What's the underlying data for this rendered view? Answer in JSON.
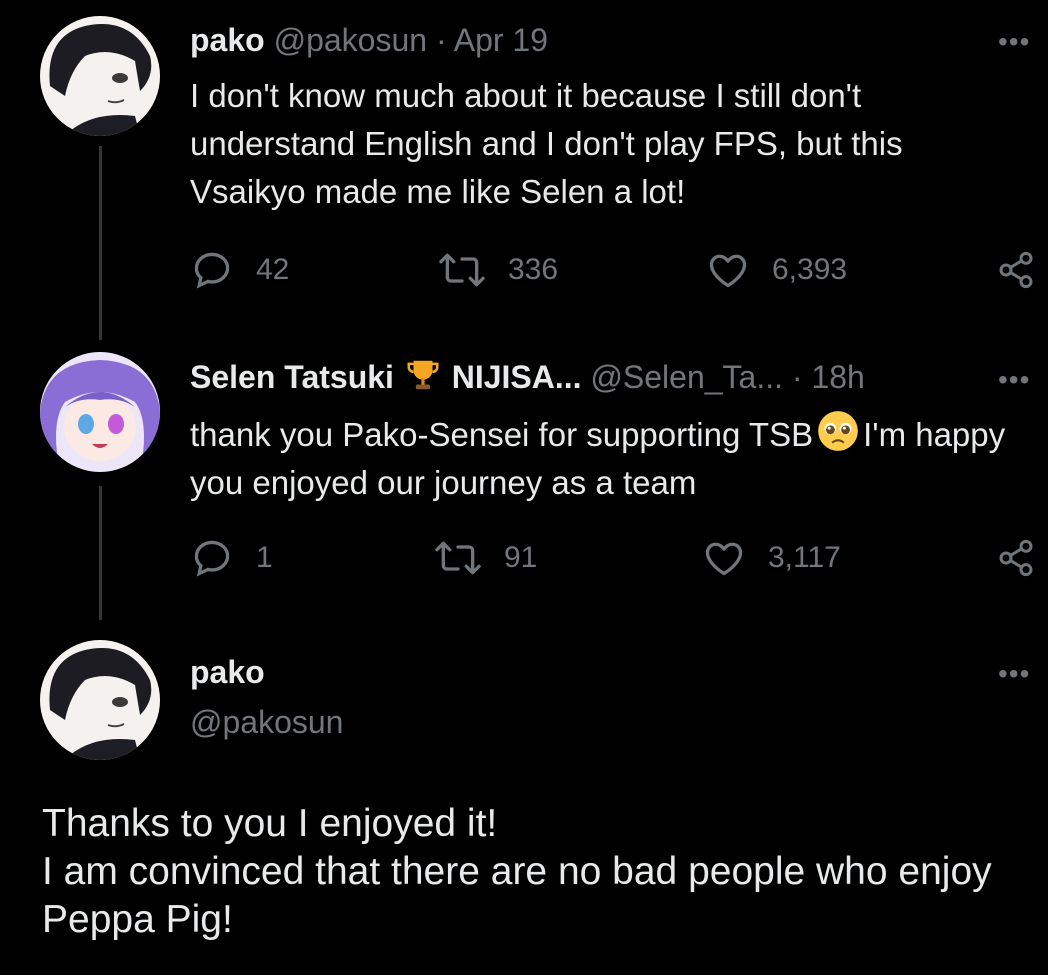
{
  "tweets": [
    {
      "name": "pako",
      "handle": "@pakosun",
      "time": "· Apr 19",
      "text": "I don't know much about it because  I still don't understand English and I don't play FPS, but this Vsaikyo made me like Selen a lot!",
      "replies": "42",
      "retweets": "336",
      "likes": "6,393"
    },
    {
      "name": "Selen Tatsuki",
      "name_suffix": "NIJISA...",
      "handle": "@Selen_Ta...",
      "time": "· 18h",
      "text_before_emoji": "thank you Pako-Sensei for supporting TSB",
      "text_after_emoji": "I'm happy you enjoyed our journey as a team",
      "replies": "1",
      "retweets": "91",
      "likes": "3,117"
    }
  ],
  "focused": {
    "name": "pako",
    "handle": "@pakosun",
    "text_lines": [
      "Thanks to you I enjoyed it!",
      "I am convinced that there are no bad people who enjoy Peppa Pig!"
    ]
  },
  "more_label": "•••",
  "colors": {
    "background": "#000000",
    "text": "#e7e9ea",
    "muted": "#71767b",
    "thread_line": "#333639"
  },
  "icons": [
    "reply-icon",
    "retweet-icon",
    "like-icon",
    "share-icon",
    "trophy-icon",
    "pleading-face-emoji"
  ]
}
